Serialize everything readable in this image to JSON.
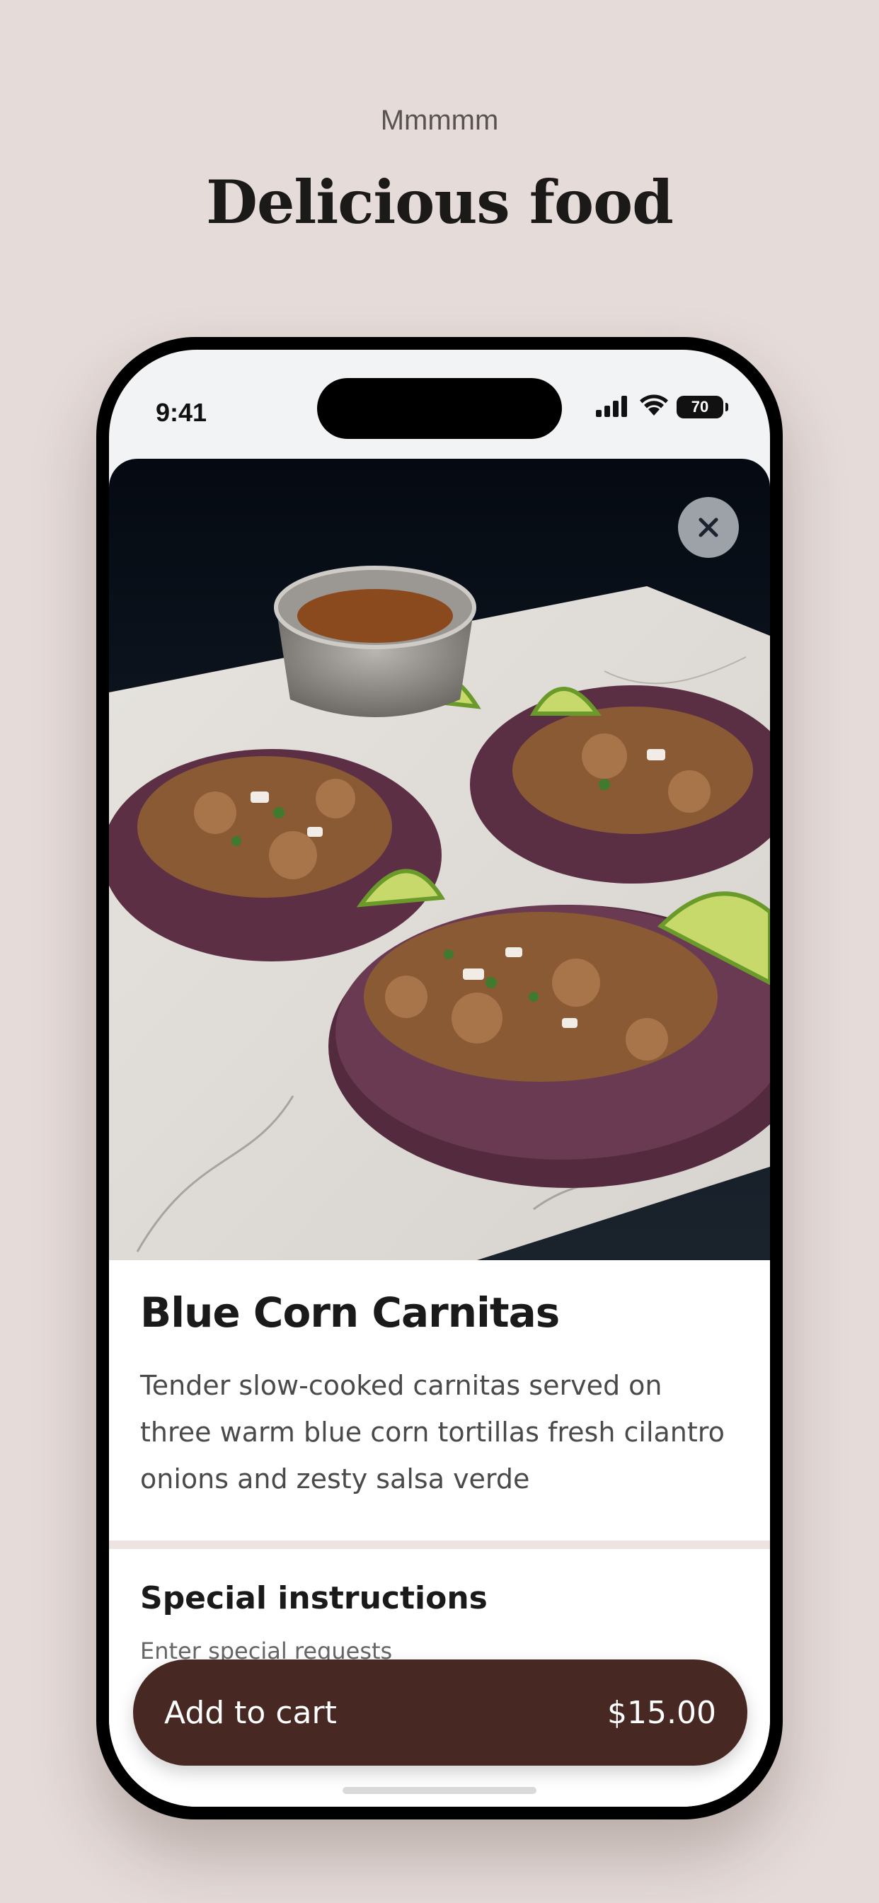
{
  "header": {
    "eyebrow": "Mmmmm",
    "headline": "Delicious food"
  },
  "status_bar": {
    "time": "9:41",
    "battery": "70",
    "icons": [
      "signal-icon",
      "wifi-icon",
      "battery-icon"
    ]
  },
  "dish": {
    "image_icon": "food-photo",
    "title": "Blue Corn Carnitas",
    "description": "Tender slow-cooked carnitas served on three warm blue corn tortillas fresh cilantro onions and zesty salsa verde"
  },
  "special_instructions": {
    "title": "Special instructions",
    "placeholder": "Enter special requests"
  },
  "cart": {
    "label": "Add to cart",
    "price": "$15.00"
  },
  "colors": {
    "background": "#e5dbd8",
    "button": "#482822",
    "divider": "#ede4e1"
  }
}
